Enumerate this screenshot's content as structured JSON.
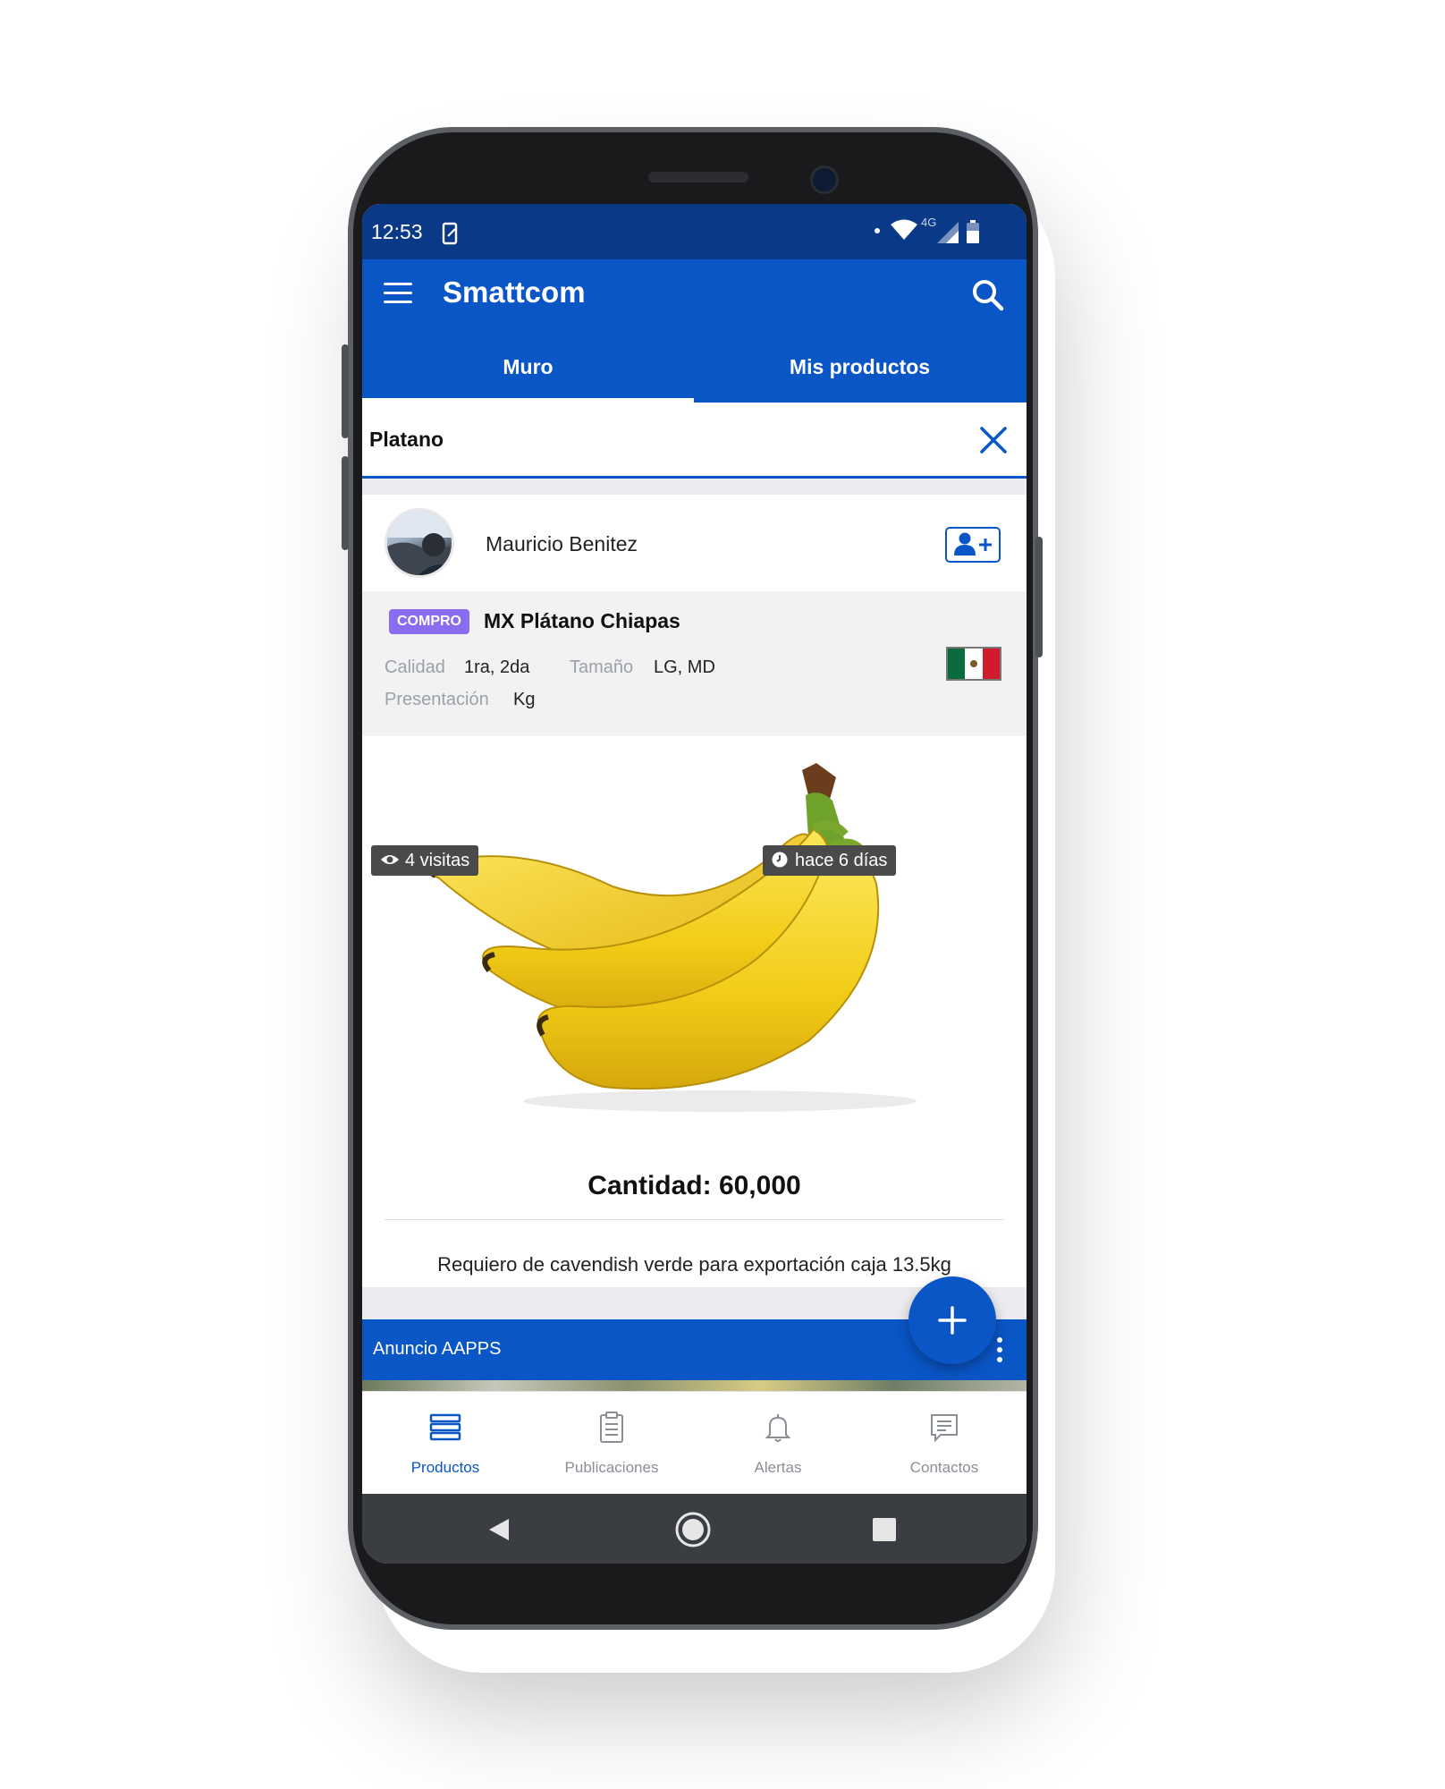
{
  "statusbar": {
    "time": "12:53",
    "network": "4G"
  },
  "app": {
    "title": "Smattcom"
  },
  "tabs": [
    {
      "label": "Muro",
      "active": true
    },
    {
      "label": "Mis productos",
      "active": false
    }
  ],
  "search": {
    "value": "Platano"
  },
  "post": {
    "user_name": "Mauricio Benitez",
    "badge": "COMPRO",
    "product_title": "MX Plátano Chiapas",
    "attributes": {
      "calidad_label": "Calidad",
      "calidad_value": "1ra, 2da",
      "tamano_label": "Tamaño",
      "tamano_value": "LG, MD",
      "presentacion_label": "Presentación",
      "presentacion_value": "Kg"
    },
    "flag_country": "Mexico",
    "visits": "4 visitas",
    "age": "hace 6 días",
    "quantity": "Cantidad: 60,000",
    "description": "Requiero de cavendish verde para exportación caja 13.5kg"
  },
  "ad": {
    "label": "Anuncio AAPPS"
  },
  "bottom_nav": [
    {
      "label": "Productos",
      "icon": "products-icon",
      "active": true
    },
    {
      "label": "Publicaciones",
      "icon": "publications-icon",
      "active": false
    },
    {
      "label": "Alertas",
      "icon": "bell-icon",
      "active": false
    },
    {
      "label": "Contactos",
      "icon": "contacts-icon",
      "active": false
    }
  ],
  "colors": {
    "primary": "#0a56c7",
    "statusbar": "#0a3a87",
    "badge": "#8a6cf0"
  }
}
